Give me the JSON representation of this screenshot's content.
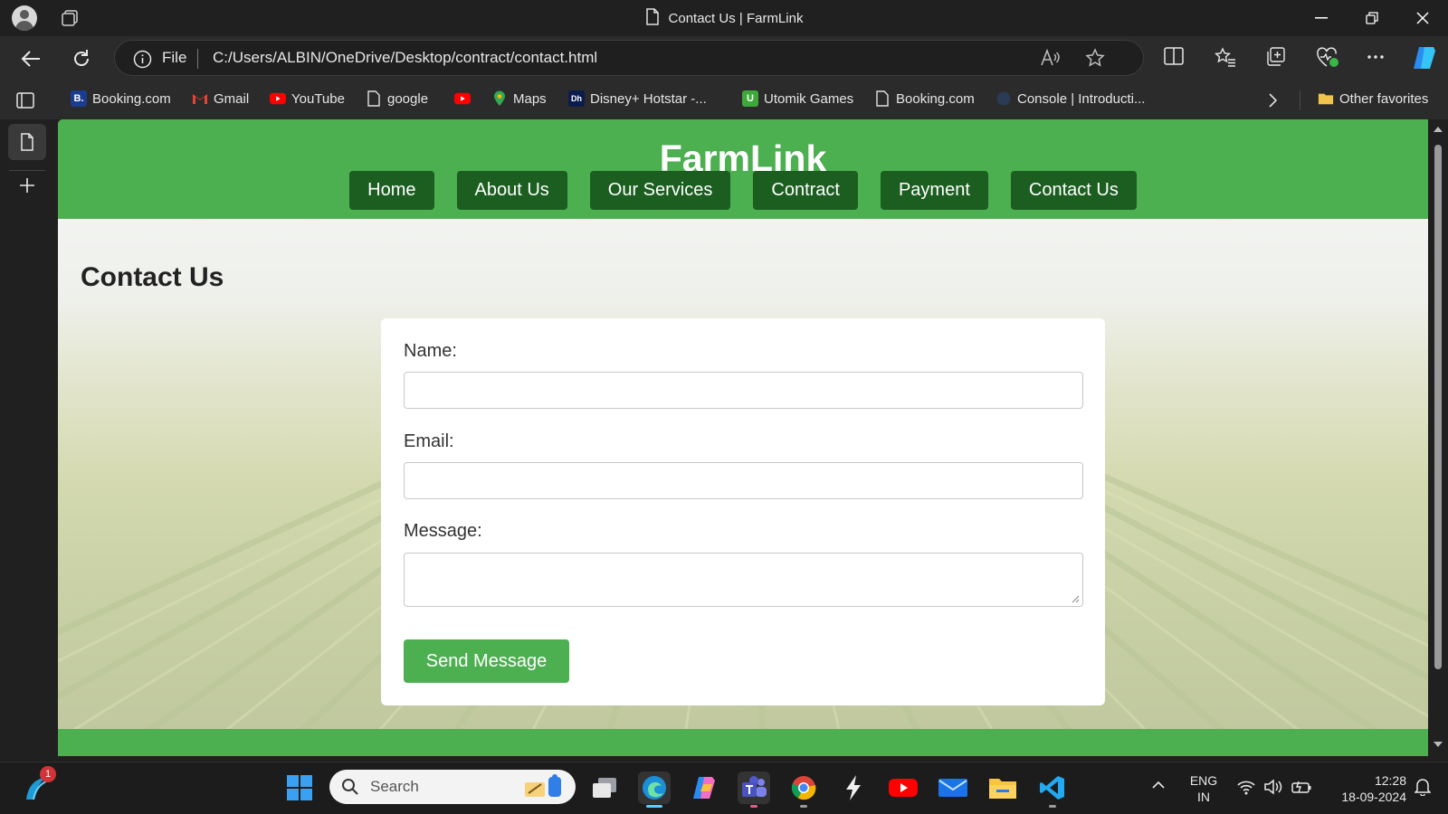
{
  "browser": {
    "tab_title": "Contact Us | FarmLink",
    "address": {
      "scheme_label": "File",
      "url": "C:/Users/ALBIN/OneDrive/Desktop/contract/contact.html"
    },
    "favorites": [
      {
        "label": "Booking.com",
        "icon": "booking-b-icon"
      },
      {
        "label": "Gmail",
        "icon": "gmail-icon"
      },
      {
        "label": "YouTube",
        "icon": "youtube-icon"
      },
      {
        "label": "google",
        "icon": "page-icon"
      },
      {
        "label": "",
        "icon": "youtube-icon"
      },
      {
        "label": "Maps",
        "icon": "maps-pin-icon"
      },
      {
        "label": "Disney+ Hotstar -...",
        "icon": "hotstar-icon"
      },
      {
        "label": "Utomik Games",
        "icon": "utomik-icon"
      },
      {
        "label": "Booking.com",
        "icon": "page-icon"
      },
      {
        "label": "Console | Introducti...",
        "icon": "console-globe-icon"
      }
    ],
    "other_favorites": "Other favorites"
  },
  "site": {
    "brand": "FarmLink",
    "nav": [
      "Home",
      "About Us",
      "Our Services",
      "Contract",
      "Payment",
      "Contact Us"
    ],
    "page_title": "Contact Us",
    "form": {
      "name_label": "Name:",
      "email_label": "Email:",
      "message_label": "Message:",
      "name_value": "",
      "email_value": "",
      "message_value": "",
      "submit_label": "Send Message"
    },
    "colors": {
      "primary_green": "#4caf50",
      "nav_button_green": "#1b5e20"
    }
  },
  "taskbar": {
    "search_placeholder": "Search",
    "notification_badge": "1",
    "language": {
      "line1": "ENG",
      "line2": "IN"
    },
    "clock": {
      "time": "12:28",
      "date": "18-09-2024"
    }
  }
}
